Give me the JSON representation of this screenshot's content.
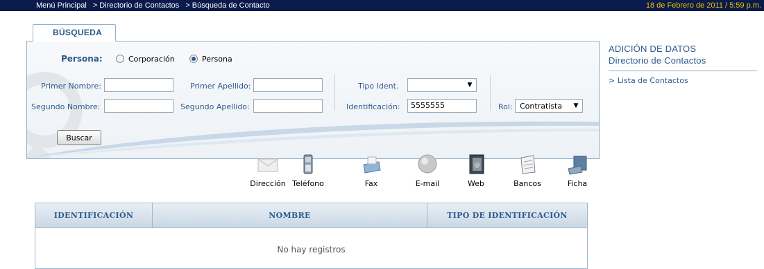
{
  "topbar": {
    "breadcrumbs": [
      "Menú Principal",
      "> Directorio de Contactos",
      "> Búsqueda de Contacto"
    ],
    "datetime": "18 de Febrero de 2011 / 5:59 p.m."
  },
  "tab": {
    "label": "BÚSQUEDA"
  },
  "form": {
    "persona_label": "Persona:",
    "radio_corporacion": "Corporación",
    "radio_persona": "Persona",
    "selected_type": "Persona",
    "primer_nombre_label": "Primer Nombre:",
    "primer_nombre_value": "",
    "segundo_nombre_label": "Segundo Nombre:",
    "segundo_nombre_value": "",
    "primer_apellido_label": "Primer Apellido:",
    "primer_apellido_value": "",
    "segundo_apellido_label": "Segundo Apellido:",
    "segundo_apellido_value": "",
    "tipo_ident_label": "Tipo Ident.",
    "tipo_ident_value": "",
    "identificacion_label": "Identificación:",
    "identificacion_value": "5555555",
    "rol_label": "Rol:",
    "rol_value": "Contratista",
    "buscar_label": "Buscar"
  },
  "toolbar": [
    {
      "label": "Dirección",
      "icon": "envelope-icon"
    },
    {
      "label": "Teléfono",
      "icon": "phone-icon"
    },
    {
      "label": "Fax",
      "icon": "fax-icon"
    },
    {
      "label": "E-mail",
      "icon": "globe-icon"
    },
    {
      "label": "Web",
      "icon": "address-book-icon"
    },
    {
      "label": "Bancos",
      "icon": "notepad-icon"
    },
    {
      "label": "Ficha",
      "icon": "computer-icon"
    }
  ],
  "table": {
    "columns": [
      "IDENTIFICACIÓN",
      "NOMBRE",
      "TIPO DE IDENTIFICACIÓN"
    ],
    "rows": [],
    "empty_message": "No hay registros"
  },
  "sidebar": {
    "title_line1": "ADICIÓN DE DATOS",
    "title_line2": "Directorio de Contactos",
    "link": "> Lista de Contactos"
  },
  "colors": {
    "topbar_bg": "#0a1a4a",
    "date_color": "#f2c200",
    "label_blue": "#2b5a8c"
  }
}
